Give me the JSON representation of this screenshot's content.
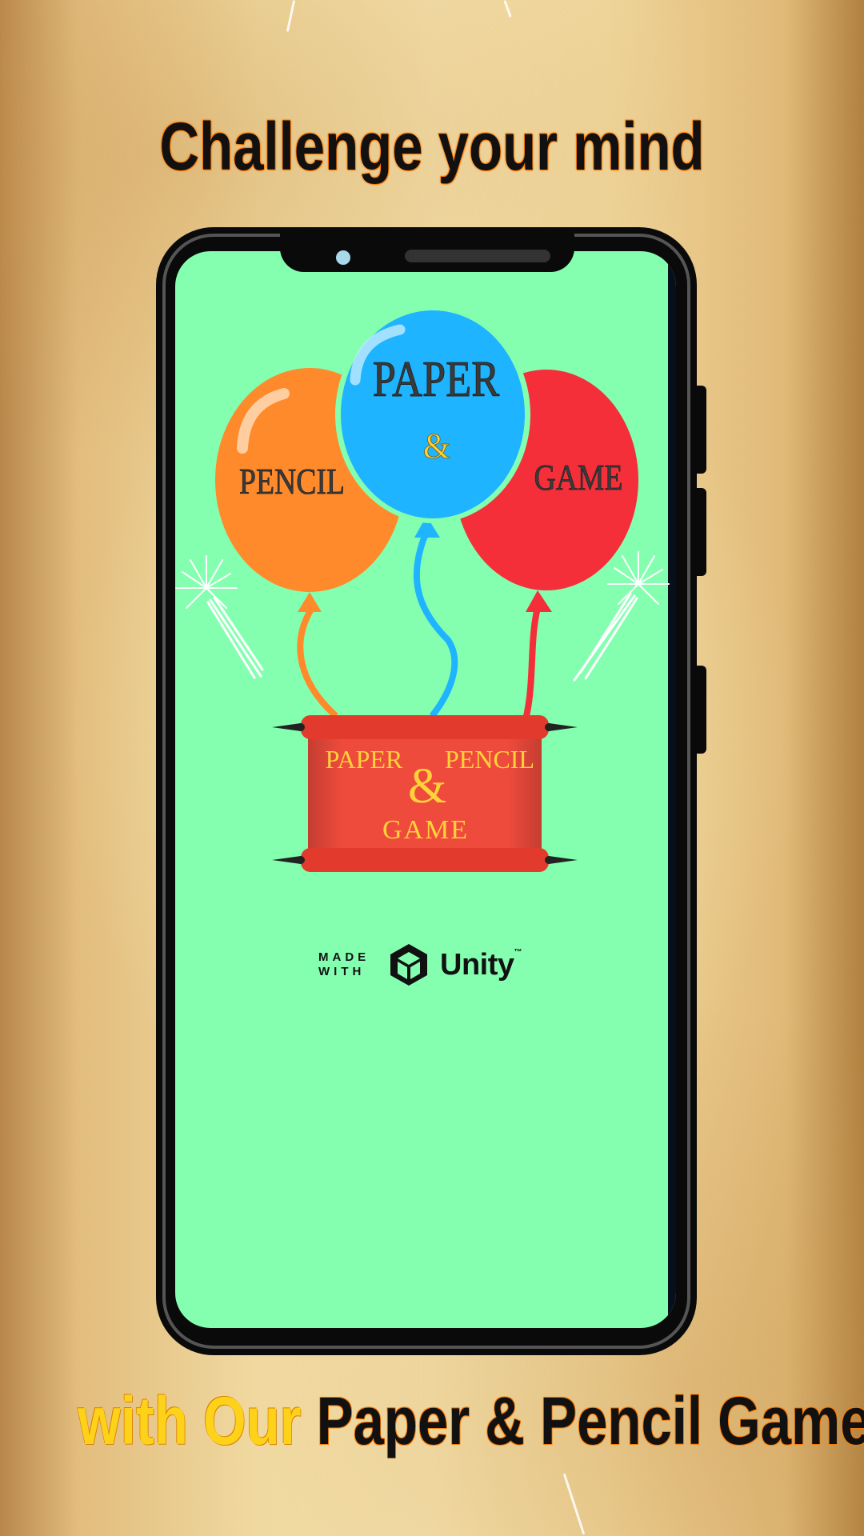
{
  "headline": {
    "top": "Challenge your mind",
    "bottom_highlight": "with Our",
    "bottom_main": "Paper & Pencil Game"
  },
  "game_screen": {
    "balloons": {
      "left": "PENCIL",
      "center_top": "PAPER",
      "center_amp": "&",
      "right": "GAME"
    },
    "scroll": {
      "word_left": "PAPER",
      "word_right": "PENCIL",
      "amp": "&",
      "word_bottom": "GAME"
    },
    "splash": {
      "made_with": "MADE WITH",
      "brand": "Unity",
      "tm": "™"
    }
  },
  "colors": {
    "screen_bg": "#84ffb0",
    "balloon_orange": "#ff8a2b",
    "balloon_blue": "#1fb4ff",
    "balloon_red": "#f52f3a",
    "scroll_red": "#ef4b3c",
    "gold_text": "#ffd23a"
  },
  "icons": [
    "unity-cube-icon",
    "firework-icon"
  ]
}
